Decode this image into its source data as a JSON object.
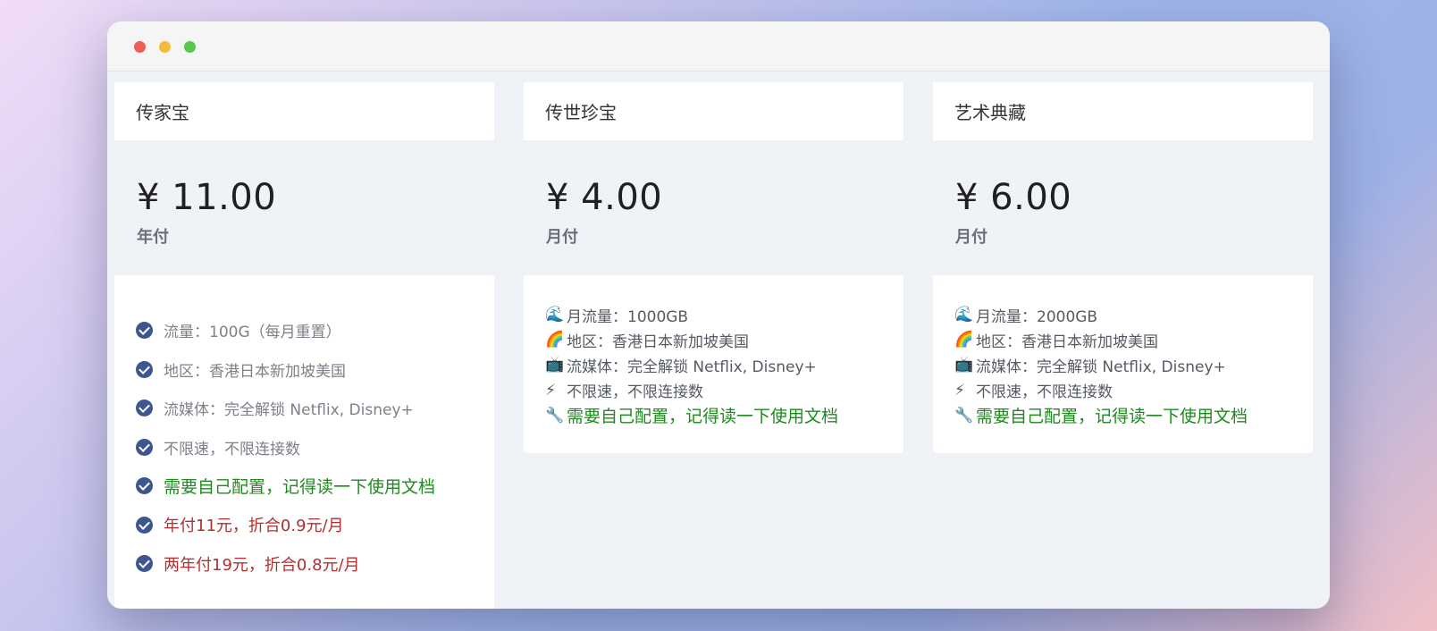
{
  "window": {
    "controls": [
      "close",
      "minimize",
      "maximize"
    ]
  },
  "plans": [
    {
      "name": "传家宝",
      "price": "¥ 11.00",
      "period": "年付",
      "features": [
        "流量：100G（每月重置）",
        "地区：香港日本新加坡美国",
        "流媒体：完全解锁 Netflix, Disney+",
        "不限速，不限连接数",
        "需要自己配置，记得读一下使用文档",
        "年付11元，折合0.9元/月",
        "两年付19元，折合0.8元/月"
      ]
    },
    {
      "name": "传世珍宝",
      "price": "¥ 4.00",
      "period": "月付",
      "features": [
        {
          "icon": "🌊",
          "text": "月流量：1000GB"
        },
        {
          "icon": "🌈",
          "text": "地区：香港日本新加坡美国"
        },
        {
          "icon": "📺",
          "text": "流媒体：完全解锁 Netflix, Disney+"
        },
        {
          "icon": "⚡",
          "text": "不限速，不限连接数"
        },
        {
          "icon": "🔧",
          "text": "需要自己配置，记得读一下使用文档"
        }
      ]
    },
    {
      "name": "艺术典藏",
      "price": "¥ 6.00",
      "period": "月付",
      "features": [
        {
          "icon": "🌊",
          "text": "月流量：2000GB"
        },
        {
          "icon": "🌈",
          "text": "地区：香港日本新加坡美国"
        },
        {
          "icon": "📺",
          "text": "流媒体：完全解锁 Netflix, Disney+"
        },
        {
          "icon": "⚡",
          "text": "不限速，不限连接数"
        },
        {
          "icon": "🔧",
          "text": "需要自己配置，记得读一下使用文档"
        }
      ]
    }
  ],
  "colors": {
    "check": "#3e5690",
    "highlight_green": "#1f8a1f",
    "highlight_red": "#b03030"
  }
}
